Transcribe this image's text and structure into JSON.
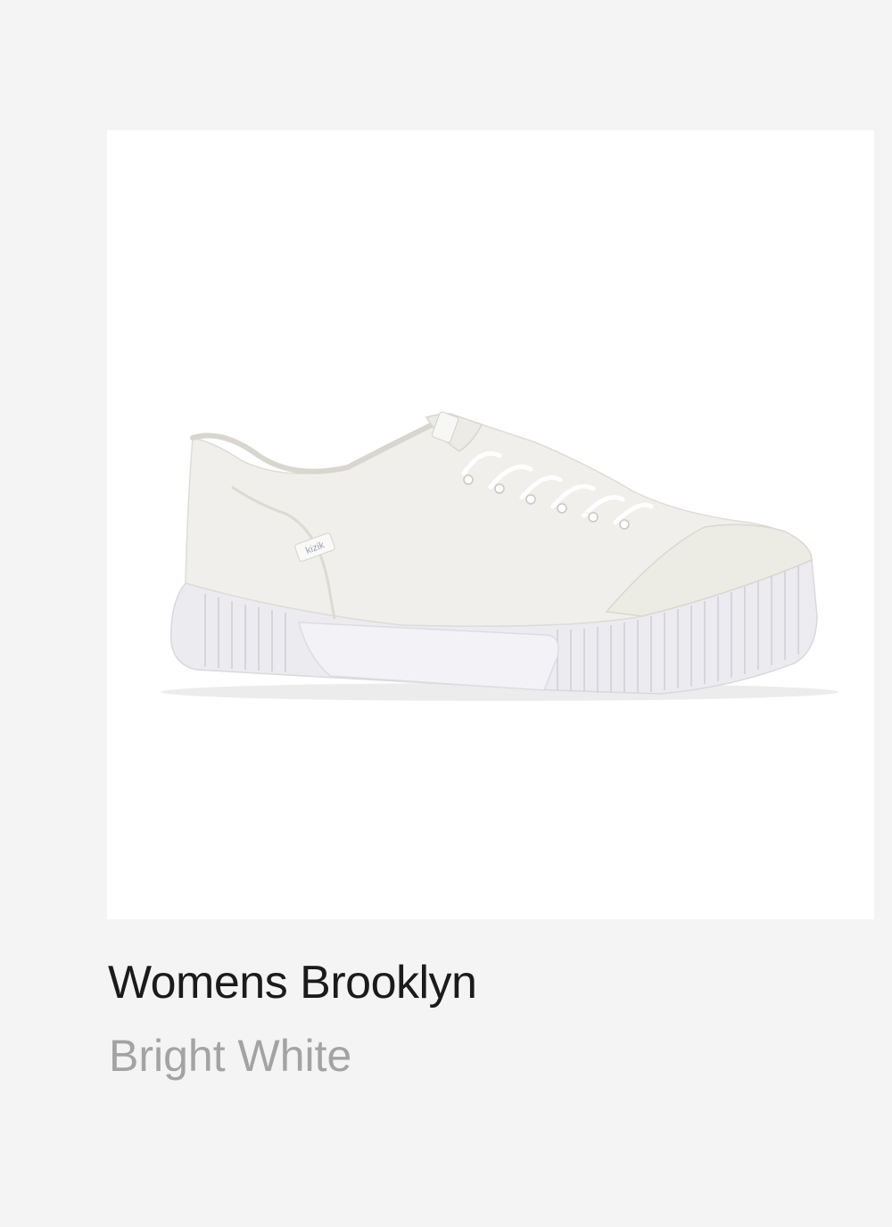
{
  "product": {
    "name": "Womens Brooklyn",
    "color": "Bright White",
    "image_alt": "Womens Brooklyn sneaker in Bright White",
    "brand_label": "kizik",
    "image_background": "#ffffff",
    "shoe_color": "#efefec"
  }
}
